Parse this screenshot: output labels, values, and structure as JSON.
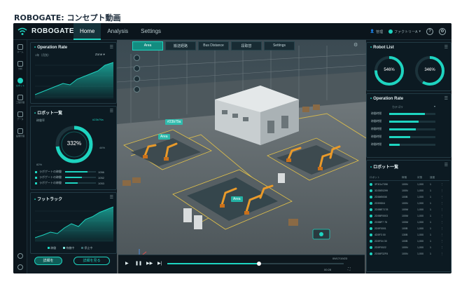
{
  "caption": "ROBOGATE: コンセプト動画",
  "app": {
    "brand": "ROBOGATE"
  },
  "nav": [
    {
      "label": "Home",
      "active": true
    },
    {
      "label": "Analysis",
      "active": false
    },
    {
      "label": "Settings",
      "active": false
    }
  ],
  "topright": {
    "user": "管理",
    "factory": "ファクトリーA",
    "help": "?",
    "settings": "⚙"
  },
  "rail": [
    {
      "label": "ホーム",
      "icon": "home-icon"
    },
    {
      "label": "分析",
      "icon": "analytics-icon"
    },
    {
      "label": "ロボット",
      "icon": "robot-icon",
      "active": true
    },
    {
      "label": "工程管理",
      "icon": "process-icon"
    },
    {
      "label": "データ",
      "icon": "data-icon"
    },
    {
      "label": "設備管理",
      "icon": "equipment-icon"
    }
  ],
  "operation_rate": {
    "title": "Operation Rate",
    "range": "1年（月別）",
    "zone": "Zone"
  },
  "robot_panel": {
    "title": "ロボット一覧",
    "sub_left": "稼働率",
    "robot_id": "#23b79a",
    "gauge_value": "332%",
    "gauge_right": "44%",
    "gauge_left": "82%",
    "legend": [
      {
        "label": "ラボゲートの稼働",
        "value": "1056",
        "fill": 0.72
      },
      {
        "label": "ラボゲートの稼働",
        "value": "1052",
        "fill": 0.55
      },
      {
        "label": "ラボゲートの稼働",
        "value": "1053",
        "fill": 0.4
      }
    ]
  },
  "footprint": {
    "title": "フットラック",
    "legend": [
      "稼働",
      "待機中",
      "停止中"
    ]
  },
  "buttons": {
    "primary": "詳細を",
    "secondary": "詳細を見る"
  },
  "scene_tabs": [
    {
      "label": "Area",
      "active": true
    },
    {
      "label": "搬送経路",
      "active": false
    },
    {
      "label": "Bus Distance",
      "active": false
    },
    {
      "label": "段取替",
      "active": false
    },
    {
      "label": "Settings",
      "active": false
    }
  ],
  "scene_labels": {
    "robot_tag": "#23b79a",
    "area1": "Area",
    "area2": "Area"
  },
  "robot_list": {
    "title": "Robot List",
    "ring1": "546%",
    "ring2": "346%"
  },
  "operation_rate_right": {
    "title": "Operation Rate",
    "header": "カテゴリ",
    "rows": [
      {
        "label": "稼働時間",
        "fill": 0.78
      },
      {
        "label": "稼働時間",
        "fill": 0.64
      },
      {
        "label": "稼働時間",
        "fill": 0.58
      },
      {
        "label": "稼働時間",
        "fill": 0.45
      },
      {
        "label": "稼働時間",
        "fill": 0.22
      }
    ]
  },
  "robot_table": {
    "title": "ロボット一覧",
    "columns": [
      "ロボット",
      "稼働",
      "状態",
      "速度",
      ""
    ],
    "rows": [
      [
        "3F3Gc7398",
        "100N",
        "1,000",
        "1"
      ],
      [
        "3D35E0299",
        "100N",
        "1,000",
        "1"
      ],
      [
        "2D58f0008",
        "100B",
        "1,000",
        "1"
      ],
      [
        "2D59D04",
        "100N",
        "1,000",
        "1"
      ],
      [
        "2D5BE7178",
        "100M",
        "1,000",
        "1"
      ],
      [
        "2D5BF0003",
        "100M",
        "1,000",
        "1"
      ],
      [
        "2D5BF7 76",
        "100M",
        "1,000",
        "1"
      ],
      [
        "2D5F0001",
        "100B",
        "1,000",
        "1"
      ],
      [
        "4D5F3 00",
        "130B",
        "1,000",
        "1"
      ],
      [
        "2D5F04 30",
        "100B",
        "1,000",
        "1"
      ],
      [
        "2D5F0022",
        "100N",
        "1,000",
        "1"
      ],
      [
        "2D58F32F8",
        "100N",
        "1,000",
        "1"
      ]
    ]
  },
  "playback": {
    "progress": 0.52,
    "date": "09/17/19/23",
    "time": "00:28"
  },
  "colors": {
    "accent": "#1ed4c0",
    "bg": "#0e1a22",
    "panel": "#0d1b22"
  }
}
